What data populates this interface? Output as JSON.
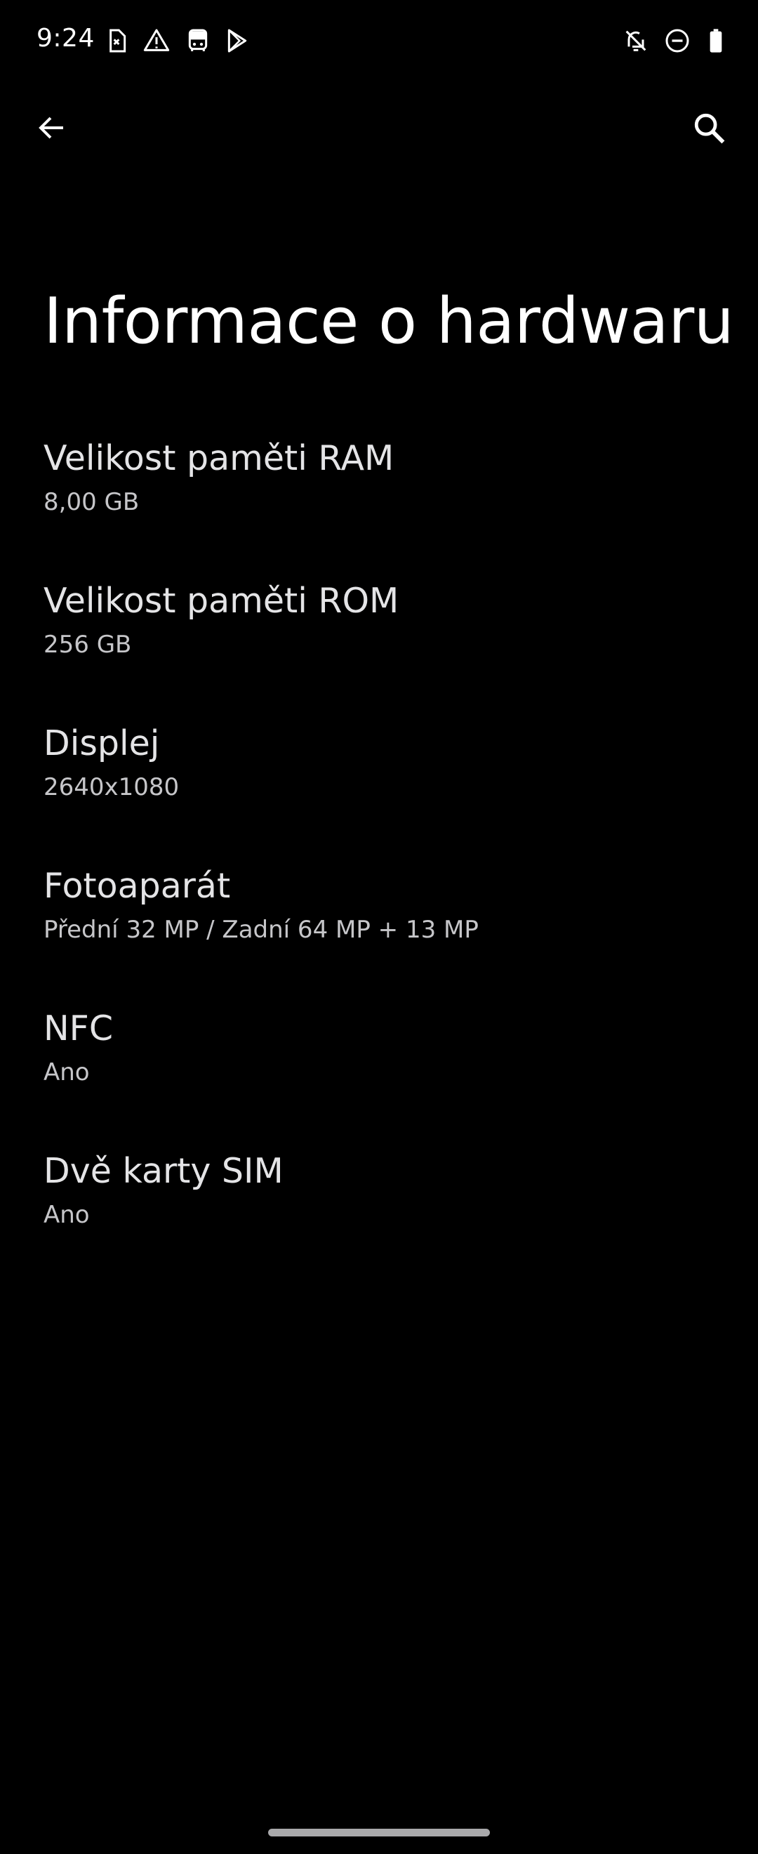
{
  "status_bar": {
    "time": "9:24",
    "icons_left": [
      "sim-error-icon",
      "warning-icon",
      "transit-icon",
      "play-store-icon"
    ],
    "icons_right": [
      "notifications-off-icon",
      "do-not-disturb-icon",
      "battery-icon"
    ]
  },
  "app_bar": {
    "back_icon": "arrow-back-icon",
    "search_icon": "search-icon"
  },
  "page": {
    "title": "Informace o hardwaru"
  },
  "items": [
    {
      "title": "Velikost paměti RAM",
      "summary": "8,00 GB"
    },
    {
      "title": "Velikost paměti ROM",
      "summary": "256 GB"
    },
    {
      "title": "Displej",
      "summary": "2640x1080"
    },
    {
      "title": "Fotoaparát",
      "summary": "Přední 32 MP / Zadní 64 MP + 13 MP"
    },
    {
      "title": "NFC",
      "summary": "Ano"
    },
    {
      "title": "Dvě karty SIM",
      "summary": "Ano"
    }
  ],
  "colors": {
    "background": "#000000",
    "title": "#ffffff",
    "item_title": "#e4e4e6",
    "item_summary": "#c6c6c9"
  }
}
